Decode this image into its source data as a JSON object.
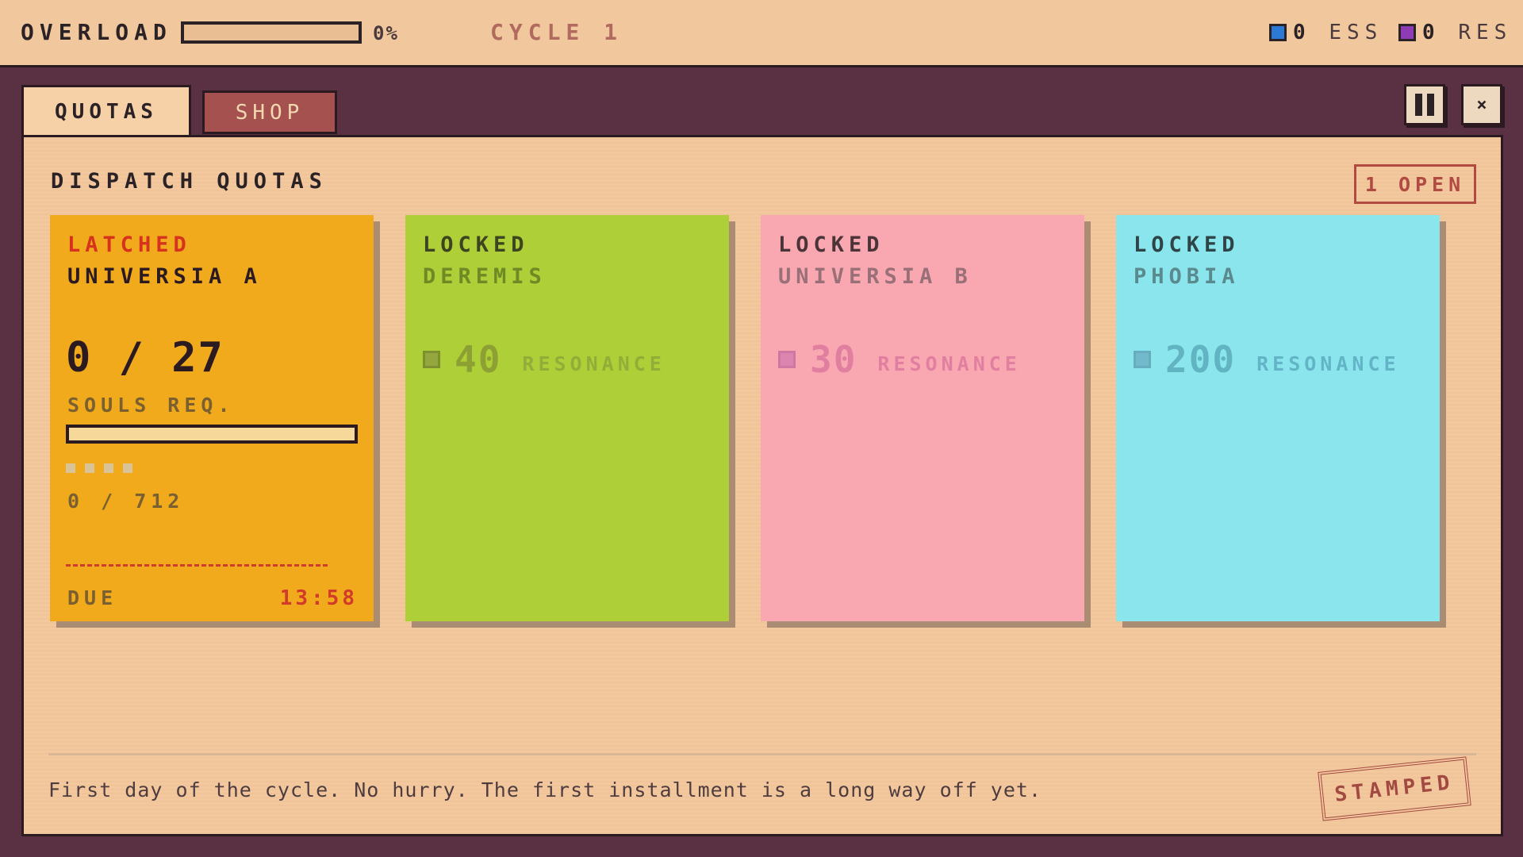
{
  "topbar": {
    "overload_label": "OVERLOAD",
    "overload_value": 0,
    "overload_pct": "0%",
    "cycle": "CYCLE 1",
    "essence": {
      "count": "0",
      "unit": "ESS",
      "color": "#2b7bd6"
    },
    "resonance": {
      "count": "0",
      "unit": "RES",
      "color": "#8e3cb6"
    }
  },
  "tabs": [
    {
      "label": "QUOTAS",
      "active": true
    },
    {
      "label": "SHOP",
      "active": false
    }
  ],
  "window_controls": {
    "pause_icon": "pause-icon",
    "close": "×"
  },
  "panel": {
    "title": "DISPATCH QUOTAS",
    "open_badge": "1 OPEN",
    "cards": [
      {
        "status": "LATCHED",
        "name": "UNIVERSIA A",
        "color": "#f0aa1c",
        "souls_count": "0 / 27",
        "souls_label": "SOULS REQ.",
        "souls_progress": 0,
        "quota_progress": "0 / 712",
        "due_label": "DUE",
        "due_time": "13:58"
      },
      {
        "status": "LOCKED",
        "name": "DEREMIS",
        "color": "#aecf38",
        "cost": "40",
        "cost_unit": "RESONANCE"
      },
      {
        "status": "LOCKED",
        "name": "UNIVERSIA B",
        "color": "#f9a8b1",
        "cost": "30",
        "cost_unit": "RESONANCE"
      },
      {
        "status": "LOCKED",
        "name": "PHOBIA",
        "color": "#8ae6ec",
        "cost": "200",
        "cost_unit": "RESONANCE"
      }
    ],
    "footer_text": "First day of the cycle. No hurry. The first installment is a long way off yet.",
    "stamp": "STAMPED"
  }
}
